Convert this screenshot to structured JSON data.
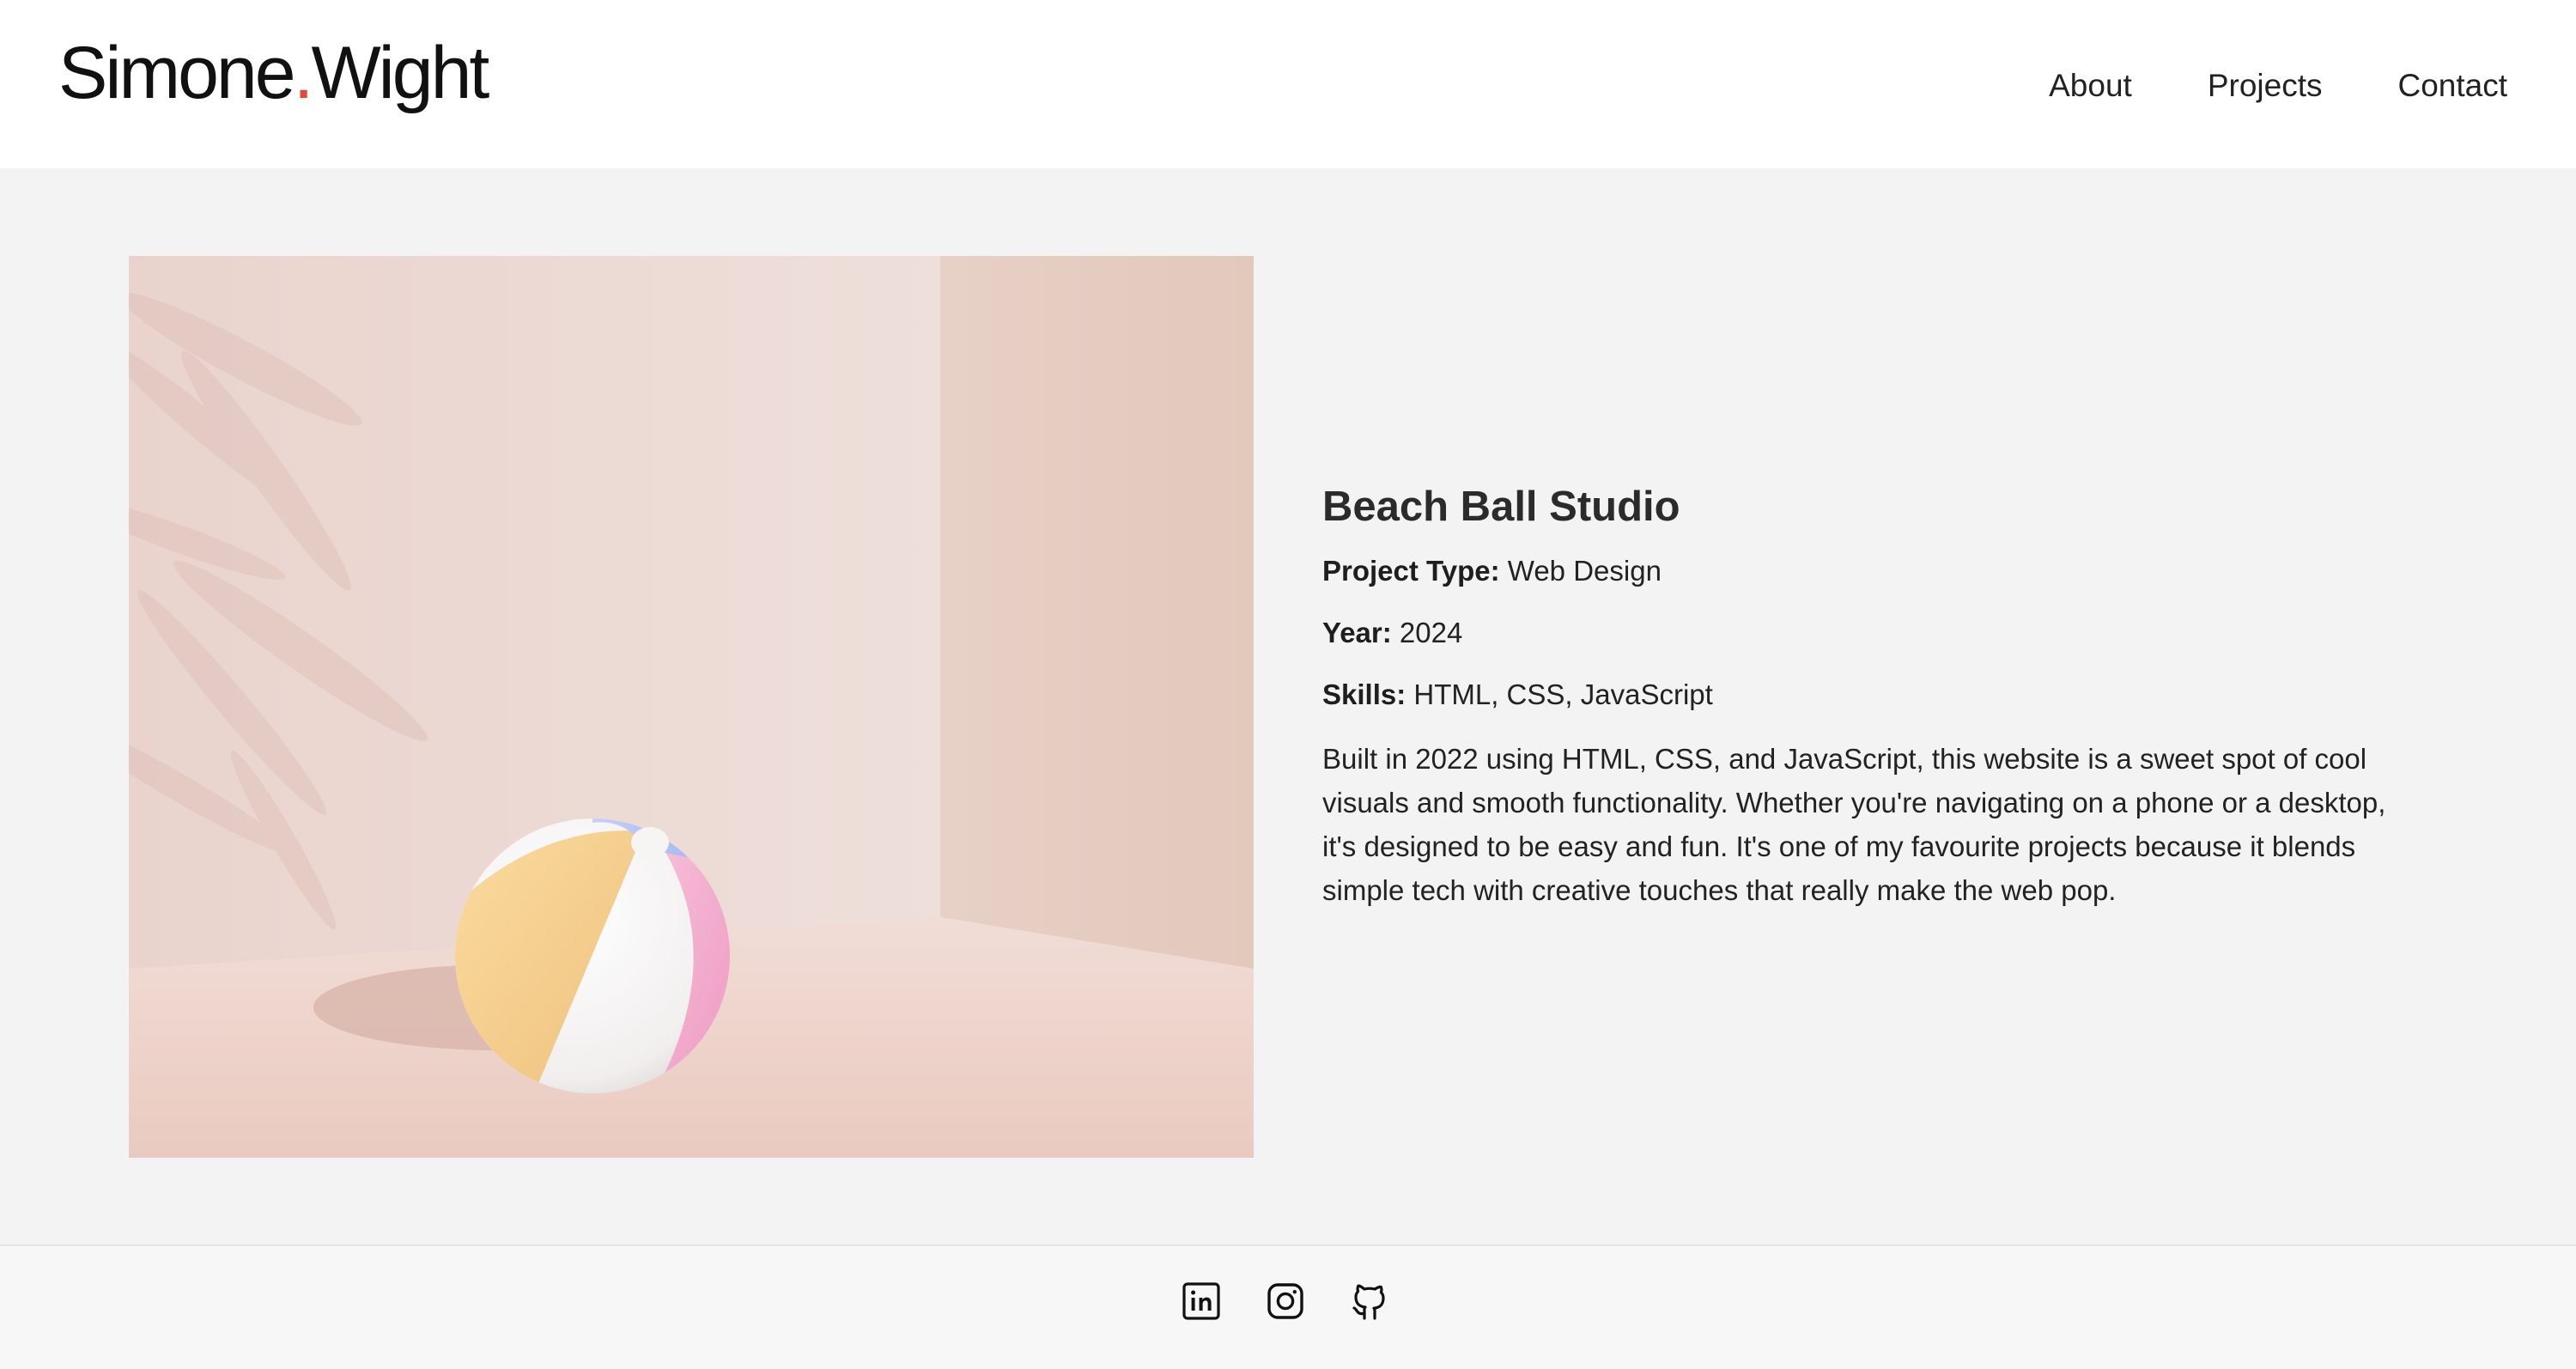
{
  "header": {
    "logo_first": "Simone",
    "logo_dot": ".",
    "logo_last": "Wight",
    "nav": [
      {
        "label": "About"
      },
      {
        "label": "Projects"
      },
      {
        "label": "Contact"
      }
    ]
  },
  "project": {
    "title": "Beach Ball Studio",
    "type_label": "Project Type:",
    "type_value": "Web Design",
    "year_label": "Year:",
    "year_value": "2024",
    "skills_label": "Skills:",
    "skills_value": "HTML, CSS, JavaScript",
    "description": "Built in 2022 using HTML, CSS, and JavaScript, this website is a sweet spot of cool visuals and smooth functionality. Whether you're navigating on a phone or a desktop, it's designed to be easy and fun. It's one of my favourite projects because it blends simple tech with creative touches that really make the web pop."
  },
  "footer": {
    "social_icons": [
      "linkedin-icon",
      "instagram-icon",
      "github-icon"
    ]
  },
  "colors": {
    "logo_dot": "#e4483e",
    "page_bg": "#f3f3f3",
    "header_bg": "#ffffff"
  }
}
